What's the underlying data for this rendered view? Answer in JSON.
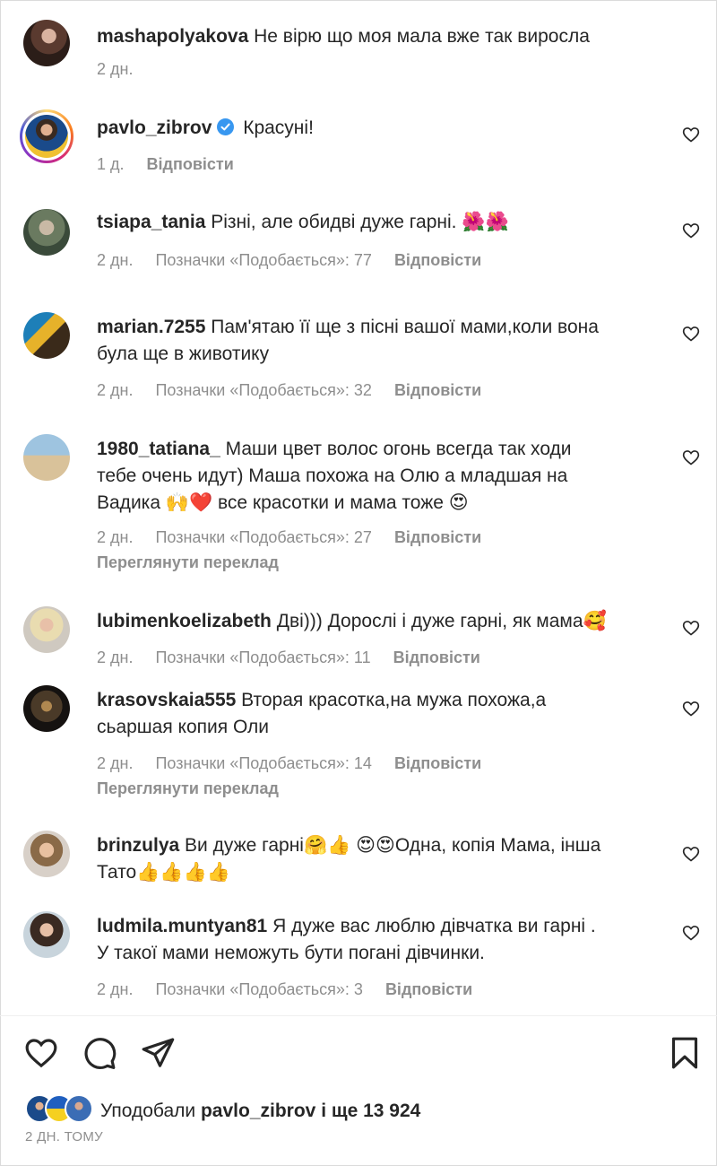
{
  "comments": [
    {
      "username": "mashapolyakova",
      "text": "Не вірю що моя мала вже так виросла",
      "time": "2 дн.",
      "likes_label": "",
      "reply": ""
    },
    {
      "username": "pavlo_zibrov",
      "text": "Красуні!",
      "time": "1 д.",
      "likes_label": "",
      "reply": "Відповісти",
      "verified": true
    },
    {
      "username": "tsiapa_tania",
      "text": "Різні, але обидві дуже гарні. 🌺🌺",
      "time": "2 дн.",
      "likes_label": "Позначки «Подобається»: 77",
      "reply": "Відповісти"
    },
    {
      "username": "marian.7255",
      "text": "Пам'ятаю її ще з пісні вашої мами,коли вона",
      "text2": "була ще в животику",
      "time": "2 дн.",
      "likes_label": "Позначки «Подобається»: 32",
      "reply": "Відповісти"
    },
    {
      "username": "1980_tatiana_",
      "text": "Маши цвет волос огонь всегда так ходи",
      "text2": "тебе очень идут) Маша похожа на Олю а младшая на",
      "text3": "Вадика 🙌❤️ все красотки и мама тоже 😍",
      "time": "2 дн.",
      "likes_label": "Позначки «Подобається»: 27",
      "reply": "Відповісти",
      "translate": "Переглянути переклад"
    },
    {
      "username": "lubimenkoelizabeth",
      "text": "Дві))) Дорослі і дуже гарні, як мама🥰",
      "time": "2 дн.",
      "likes_label": "Позначки «Подобається»: 11",
      "reply": "Відповісти"
    },
    {
      "username": "krasovskaia555",
      "text": "Вторая красотка,на мужа похожа,а",
      "text2": "сьаршая копия Оли",
      "time": "2 дн.",
      "likes_label": "Позначки «Подобається»: 14",
      "reply": "Відповісти",
      "translate": "Переглянути переклад"
    },
    {
      "username": "brinzulya",
      "text": "Ви дуже гарні🤗👍 😍😍Одна, копія Мама, інша",
      "text2": "Тато👍👍👍👍",
      "time": "",
      "likes_label": "",
      "reply": ""
    },
    {
      "username": "ludmila.muntyan81",
      "text": "Я дуже вас люблю дівчатка ви гарні .",
      "text2": "У такої мами неможуть бути погані дівчинки.",
      "time": "2 дн.",
      "likes_label": "Позначки «Подобається»: 3",
      "reply": "Відповісти"
    }
  ],
  "likes": {
    "prefix": "Уподобали",
    "user": "pavlo_zibrov",
    "suffix": "і ще 13 924"
  },
  "time_ago": "2 ДН. ТОМУ",
  "icons": {
    "like": "heart-icon",
    "comment": "comment-icon",
    "share": "paper-plane-icon",
    "save": "bookmark-icon"
  },
  "colors": {
    "text": "#262626",
    "muted": "#8e8e8e",
    "verified": "#3897f0"
  }
}
